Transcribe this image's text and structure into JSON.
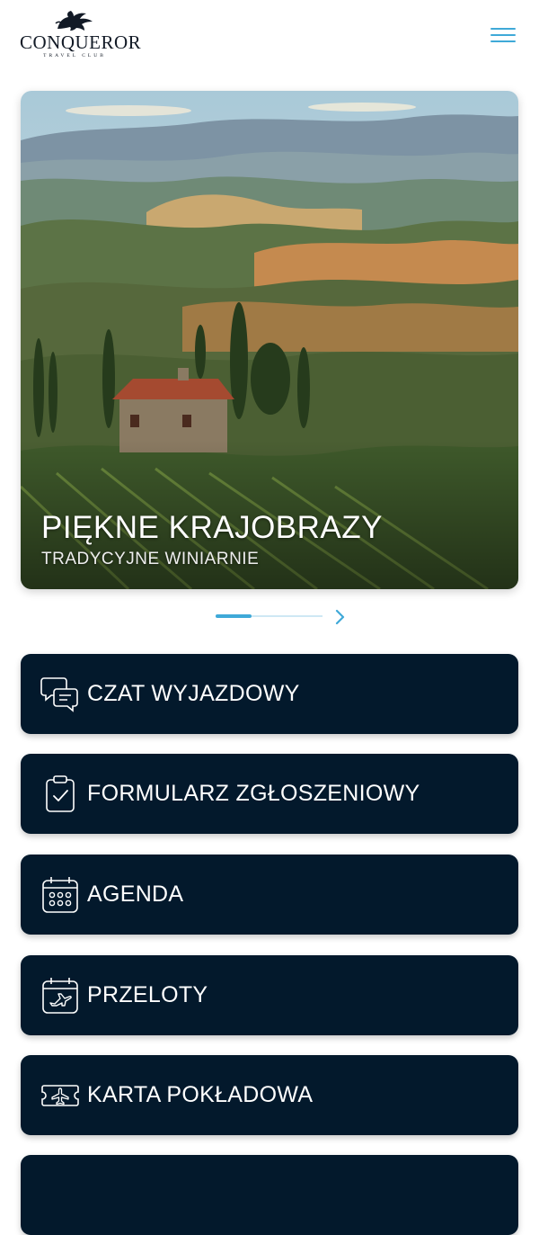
{
  "header": {
    "logo_name": "CONQUEROR",
    "logo_sub": "TRAVEL CLUB",
    "logo_icon": "griffin-icon",
    "menu_icon": "hamburger-menu-icon",
    "accent_color": "#3fa9d8"
  },
  "hero": {
    "title": "PIĘKNE KRAJOBRAZY",
    "subtitle": "TRADYCYJNE WINIARNIE",
    "slide_progress": 0.34
  },
  "tiles": [
    {
      "label": "CZAT WYJAZDOWY",
      "icon": "chat-bubbles-icon"
    },
    {
      "label": "FORMULARZ ZGŁOSZENIOWY",
      "icon": "clipboard-check-icon"
    },
    {
      "label": "AGENDA",
      "icon": "calendar-icon"
    },
    {
      "label": "PRZELOTY",
      "icon": "calendar-plane-icon"
    },
    {
      "label": "KARTA POKŁADOWA",
      "icon": "boarding-pass-icon"
    }
  ],
  "colors": {
    "tile_bg": "#03192c",
    "tile_text": "#ffffff"
  }
}
